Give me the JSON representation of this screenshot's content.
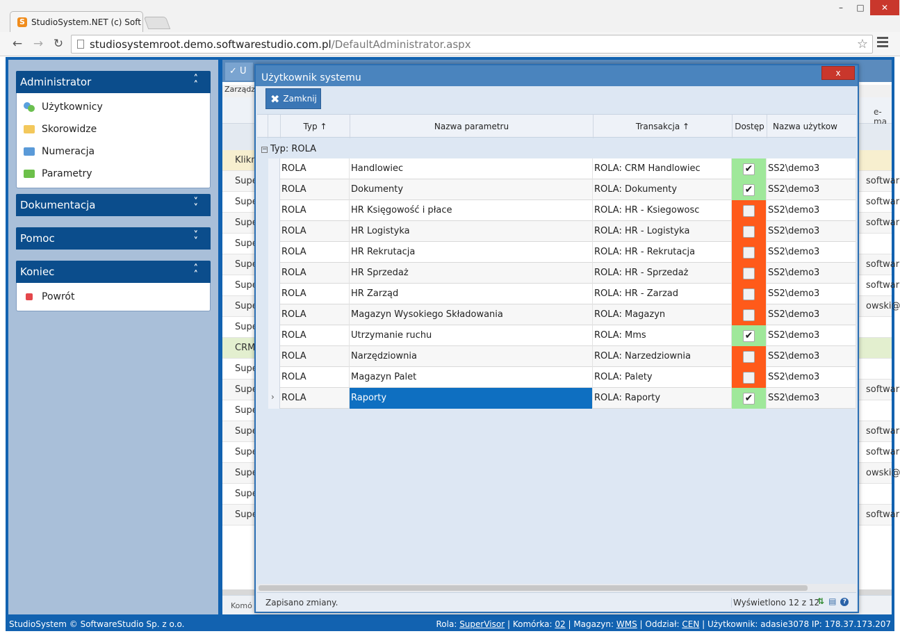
{
  "browser": {
    "tab_title": "StudioSystem.NET (c) Soft",
    "url_host": "studiosystemroot.demo.softwarestudio.com.pl",
    "url_path": "/DefaultAdministrator.aspx"
  },
  "sidebar": {
    "panels": [
      {
        "title": "Administrator",
        "expanded": true,
        "items": [
          "Użytkownicy",
          "Skorowidze",
          "Numeracja",
          "Parametry"
        ]
      },
      {
        "title": "Dokumentacja",
        "expanded": false,
        "items": []
      },
      {
        "title": "Pomoc",
        "expanded": false,
        "items": []
      },
      {
        "title": "Koniec",
        "expanded": true,
        "items": [
          "Powrót"
        ]
      }
    ]
  },
  "background": {
    "tab_label": "U",
    "breadcrumb": "Zarządz",
    "email_header": "e-ma",
    "rows": [
      {
        "c1": "Klikni",
        "c2": ""
      },
      {
        "c1": "Supe",
        "c2": "softwar"
      },
      {
        "c1": "Supe",
        "c2": "softwar"
      },
      {
        "c1": "Supe",
        "c2": "softwar"
      },
      {
        "c1": "Supe",
        "c2": ""
      },
      {
        "c1": "Supe",
        "c2": "softwar"
      },
      {
        "c1": "Supe",
        "c2": "softwar"
      },
      {
        "c1": "Supe",
        "c2": "owski@w"
      },
      {
        "c1": "Supe",
        "c2": ""
      },
      {
        "c1": "CRM",
        "c2": ""
      },
      {
        "c1": "Supe",
        "c2": ""
      },
      {
        "c1": "Supe",
        "c2": "softwar"
      },
      {
        "c1": "Supe",
        "c2": ""
      },
      {
        "c1": "Supe",
        "c2": "softwar"
      },
      {
        "c1": "Supe",
        "c2": "softwar"
      },
      {
        "c1": "Supe",
        "c2": "owski@w"
      },
      {
        "c1": "Supe",
        "c2": ""
      },
      {
        "c1": "Supe",
        "c2": "softwar"
      }
    ],
    "footer": "Komó"
  },
  "modal": {
    "title": "Użytkownik systemu",
    "close_label": "x",
    "zamknij_label": "Zamknij",
    "columns": {
      "typ": "Typ ↑",
      "nazwa": "Nazwa parametru",
      "transakcja": "Transakcja ↑",
      "dostep": "Dostęp",
      "user": "Nazwa użytkow"
    },
    "group_label": "Typ: ROLA",
    "rows": [
      {
        "typ": "ROLA",
        "nazwa": "Handlowiec",
        "transakcja": "ROLA: CRM Handlowiec",
        "dostep": true,
        "user": "SS2\\demo3"
      },
      {
        "typ": "ROLA",
        "nazwa": "Dokumenty",
        "transakcja": "ROLA: Dokumenty",
        "dostep": true,
        "user": "SS2\\demo3"
      },
      {
        "typ": "ROLA",
        "nazwa": "HR Księgowość i płace",
        "transakcja": "ROLA: HR - Ksiegowosc",
        "dostep": false,
        "user": "SS2\\demo3"
      },
      {
        "typ": "ROLA",
        "nazwa": "HR Logistyka",
        "transakcja": "ROLA: HR - Logistyka",
        "dostep": false,
        "user": "SS2\\demo3"
      },
      {
        "typ": "ROLA",
        "nazwa": "HR Rekrutacja",
        "transakcja": "ROLA: HR - Rekrutacja",
        "dostep": false,
        "user": "SS2\\demo3"
      },
      {
        "typ": "ROLA",
        "nazwa": "HR Sprzedaż",
        "transakcja": "ROLA: HR - Sprzedaż",
        "dostep": false,
        "user": "SS2\\demo3"
      },
      {
        "typ": "ROLA",
        "nazwa": "HR Zarząd",
        "transakcja": "ROLA: HR - Zarzad",
        "dostep": false,
        "user": "SS2\\demo3"
      },
      {
        "typ": "ROLA",
        "nazwa": "Magazyn Wysokiego Składowania",
        "transakcja": "ROLA: Magazyn",
        "dostep": false,
        "user": "SS2\\demo3"
      },
      {
        "typ": "ROLA",
        "nazwa": "Utrzymanie ruchu",
        "transakcja": "ROLA: Mms",
        "dostep": true,
        "user": "SS2\\demo3"
      },
      {
        "typ": "ROLA",
        "nazwa": "Narzędziownia",
        "transakcja": "ROLA: Narzedziownia",
        "dostep": false,
        "user": "SS2\\demo3"
      },
      {
        "typ": "ROLA",
        "nazwa": "Magazyn Palet",
        "transakcja": "ROLA: Palety",
        "dostep": false,
        "user": "SS2\\demo3"
      },
      {
        "typ": "ROLA",
        "nazwa": "Raporty",
        "transakcja": "ROLA: Raporty",
        "dostep": true,
        "user": "SS2\\demo3",
        "selected": true
      }
    ],
    "footer_status": "Zapisano zmiany.",
    "footer_count": "Wyświetlono 12 z 12"
  },
  "statusbar": {
    "left": "StudioSystem © SoftwareStudio Sp. z o.o.",
    "rola_label": "Rola:",
    "rola": "SuperVisor",
    "komorka_label": "Komórka:",
    "komorka": "02",
    "magazyn_label": "Magazyn:",
    "magazyn": "WMS",
    "oddzial_label": "Oddział:",
    "oddzial": "CEN",
    "uzytkownik": "Użytkownik: adasie3078 IP: 178.37.173.207"
  },
  "colors": {
    "brand_blue": "#1262b0",
    "panel_header": "#0b4d8c",
    "access_granted": "#9fe89a",
    "access_denied": "#ff5a1a",
    "selected_cell": "#0e6fc1"
  }
}
